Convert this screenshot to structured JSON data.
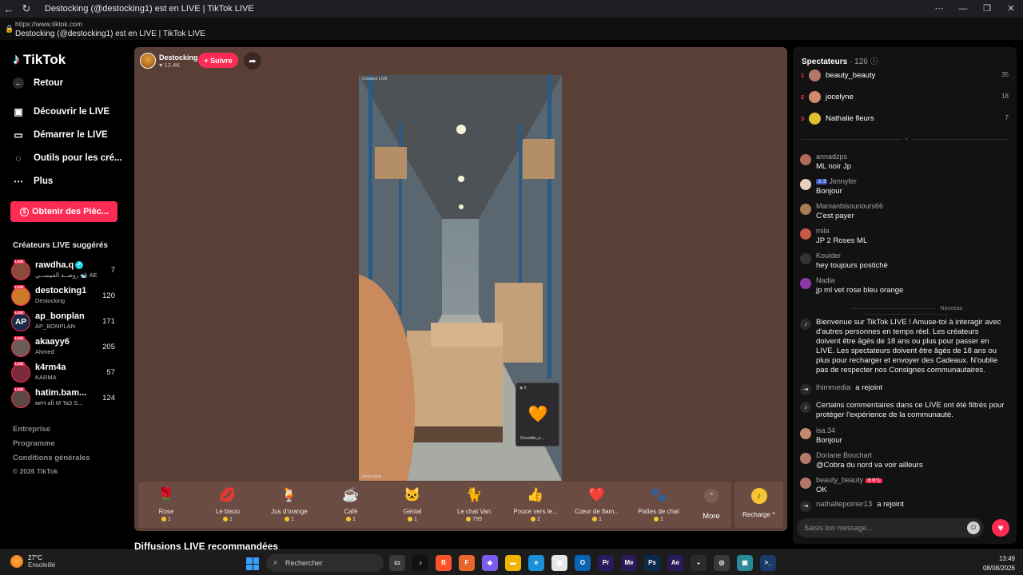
{
  "browser": {
    "tab_title": "Destocking (@destocking1) est en LIVE | TikTok LIVE",
    "url": "https://www.tiktok.com",
    "page_title": "Destocking (@destocking1) est en LIVE | TikTok LIVE"
  },
  "sidebar": {
    "logo": "TikTok",
    "back_label": "Retour",
    "nav": [
      {
        "label": "Découvrir le LIVE",
        "icon": "calendar-icon"
      },
      {
        "label": "Démarrer le LIVE",
        "icon": "camera-icon"
      },
      {
        "label": "Outils pour les cré...",
        "icon": "lightbulb-icon"
      },
      {
        "label": "Plus",
        "icon": "more-icon"
      }
    ],
    "coins_button": "Obtenir des Pièc...",
    "suggested_title": "Créateurs LIVE suggérés",
    "live_badge": "LIVE",
    "creators": [
      {
        "name": "rawdha.q",
        "sub": "روضــة القبيســي 🐋 AE",
        "count": "7",
        "verified": true,
        "avatar_color": "#8a4b3a",
        "avatar_text": ""
      },
      {
        "name": "destocking1",
        "sub": "Destocking",
        "count": "120",
        "verified": false,
        "avatar_color": "#c97b2a",
        "avatar_text": ""
      },
      {
        "name": "ap_bonplan",
        "sub": "AP_BONPLAN",
        "count": "171",
        "verified": false,
        "avatar_color": "#1a2a4a",
        "avatar_text": "AP"
      },
      {
        "name": "akaayy6",
        "sub": "Ahmed",
        "count": "205",
        "verified": false,
        "avatar_color": "#6b5d55",
        "avatar_text": ""
      },
      {
        "name": "k4rm4a",
        "sub": "KARMA",
        "count": "57",
        "verified": false,
        "avatar_color": "#7a2a3a",
        "avatar_text": ""
      },
      {
        "name": "hatim.bam...",
        "sub": "мғH аĬİ M Ta3 S...",
        "count": "124",
        "verified": false,
        "avatar_color": "#5a4a44",
        "avatar_text": ""
      }
    ],
    "footer": [
      "Entreprise",
      "Programme",
      "Conditions générales",
      "© 2026 TikTok"
    ]
  },
  "live": {
    "host_name": "Destocking",
    "host_likes": "12.4K",
    "follow_label": "+ Suivre",
    "stream_tag": "Créateur LIVE",
    "stream_watermark": "Destocking",
    "guest_name": "Geostdin_e...",
    "guest_top": "8",
    "gifts": [
      {
        "name": "Rose",
        "price": "1",
        "icon": "🌹"
      },
      {
        "name": "Le bisou",
        "price": "1",
        "icon": "💋"
      },
      {
        "name": "Jus d'orange",
        "price": "1",
        "icon": "🍹"
      },
      {
        "name": "Café",
        "price": "1",
        "icon": "☕"
      },
      {
        "name": "Génial",
        "price": "1",
        "icon": "🐱"
      },
      {
        "name": "Le chat Van",
        "price": "799",
        "icon": "🐈"
      },
      {
        "name": "Pouce vers le...",
        "price": "2",
        "icon": "👍"
      },
      {
        "name": "Cœur de flam...",
        "price": "1",
        "icon": "❤️"
      },
      {
        "name": "Pattes de chat",
        "price": "1",
        "icon": "🐾"
      }
    ],
    "more_label": "More",
    "recharge_label": "Recharge ^",
    "recommended_title": "Diffusions LIVE recommandées"
  },
  "chat": {
    "viewers_label": "Spectateurs",
    "viewers_count": "126",
    "top_viewers": [
      {
        "rank": "1",
        "name": "beauty_beauty",
        "score": "35",
        "color": "#b27766"
      },
      {
        "rank": "2",
        "name": "jocelyne",
        "score": "18",
        "color": "#d08a6a"
      },
      {
        "rank": "3",
        "name": "Nathalie fleurs",
        "score": "7",
        "color": "#e0c030"
      }
    ],
    "messages": [
      {
        "user": "annadzps",
        "text": "ML noir Jp",
        "color": "#b06a5a",
        "lvl": "",
        "fan": ""
      },
      {
        "user": "Jennyfer",
        "text": "Bonjour",
        "color": "#e8d0c0",
        "lvl": "3",
        "fan": ""
      },
      {
        "user": "Mamanbisounours66",
        "text": "C'est payer",
        "color": "#a67c52",
        "lvl": "",
        "fan": ""
      },
      {
        "user": "mila",
        "text": "JP 2 Roses ML",
        "color": "#c85a4a",
        "lvl": "",
        "fan": ""
      },
      {
        "user": "Kouider",
        "text": "hey toujours postiché",
        "color": "#333333",
        "lvl": "",
        "fan": ""
      },
      {
        "user": "Nadia",
        "text": "jp ml vet rose bleu orange",
        "color": "#8e3aa6",
        "lvl": "",
        "fan": ""
      }
    ],
    "new_label": "Nouveau",
    "welcome": "Bienvenue sur TikTok LIVE ! Amuse-toi à interagir avec d'autres personnes en temps réel. Les créateurs doivent être âgés de 18 ans ou plus pour passer en LIVE. Les spectateurs doivent être âgés de 18 ans ou plus pour recharger et envoyer des Cadeaux. N'oublie pas de respecter nos Consignes communautaires.",
    "joined1_user": "lhimmedia",
    "joined_label": "a rejoint",
    "filtered": "Certains commentaires dans ce LIVE ont été filtrés pour protéger l'expérience de la communauté.",
    "messages2": [
      {
        "user": "isa.34",
        "text": "Bonjour",
        "color": "#c48a70",
        "fan": ""
      },
      {
        "user": "Doriane Bouchart",
        "text": "@Cobra du nord va voir ailleurs",
        "color": "#b37a66",
        "fan": ""
      },
      {
        "user": "beauty_beauty",
        "text": "OK",
        "color": "#b27766",
        "fan": "6 N°1"
      }
    ],
    "joined2_user": "nathaliepoirier13",
    "input_placeholder": "Saisis ton message..."
  },
  "taskbar": {
    "temp": "27°C",
    "weather": "Ensoleillé",
    "search": "Rechercher",
    "time": "13:49",
    "date": "08/08/2026",
    "apps": [
      {
        "label": "▭",
        "color": "#3a3a3a"
      },
      {
        "label": "♪",
        "color": "#111111"
      },
      {
        "label": "B",
        "color": "#fb542b"
      },
      {
        "label": "F",
        "color": "#e8662b"
      },
      {
        "label": "◆",
        "color": "#7a5cf0"
      },
      {
        "label": "▬",
        "color": "#f0b400"
      },
      {
        "label": "e",
        "color": "#1c8fd9"
      },
      {
        "label": "▦",
        "color": "#e6e6e6"
      },
      {
        "label": "O",
        "color": "#0a64b4"
      },
      {
        "label": "Pr",
        "color": "#2a1a5a"
      },
      {
        "label": "Me",
        "color": "#2a1a5a"
      },
      {
        "label": "Ps",
        "color": "#0a2a4a"
      },
      {
        "label": "Ae",
        "color": "#2a1a5a"
      },
      {
        "label": "◒",
        "color": "#2b2b2b"
      },
      {
        "label": "◎",
        "color": "#3a3a3a"
      },
      {
        "label": "▣",
        "color": "#2a8a9a"
      },
      {
        "label": ">_",
        "color": "#1a3a6a"
      }
    ]
  }
}
